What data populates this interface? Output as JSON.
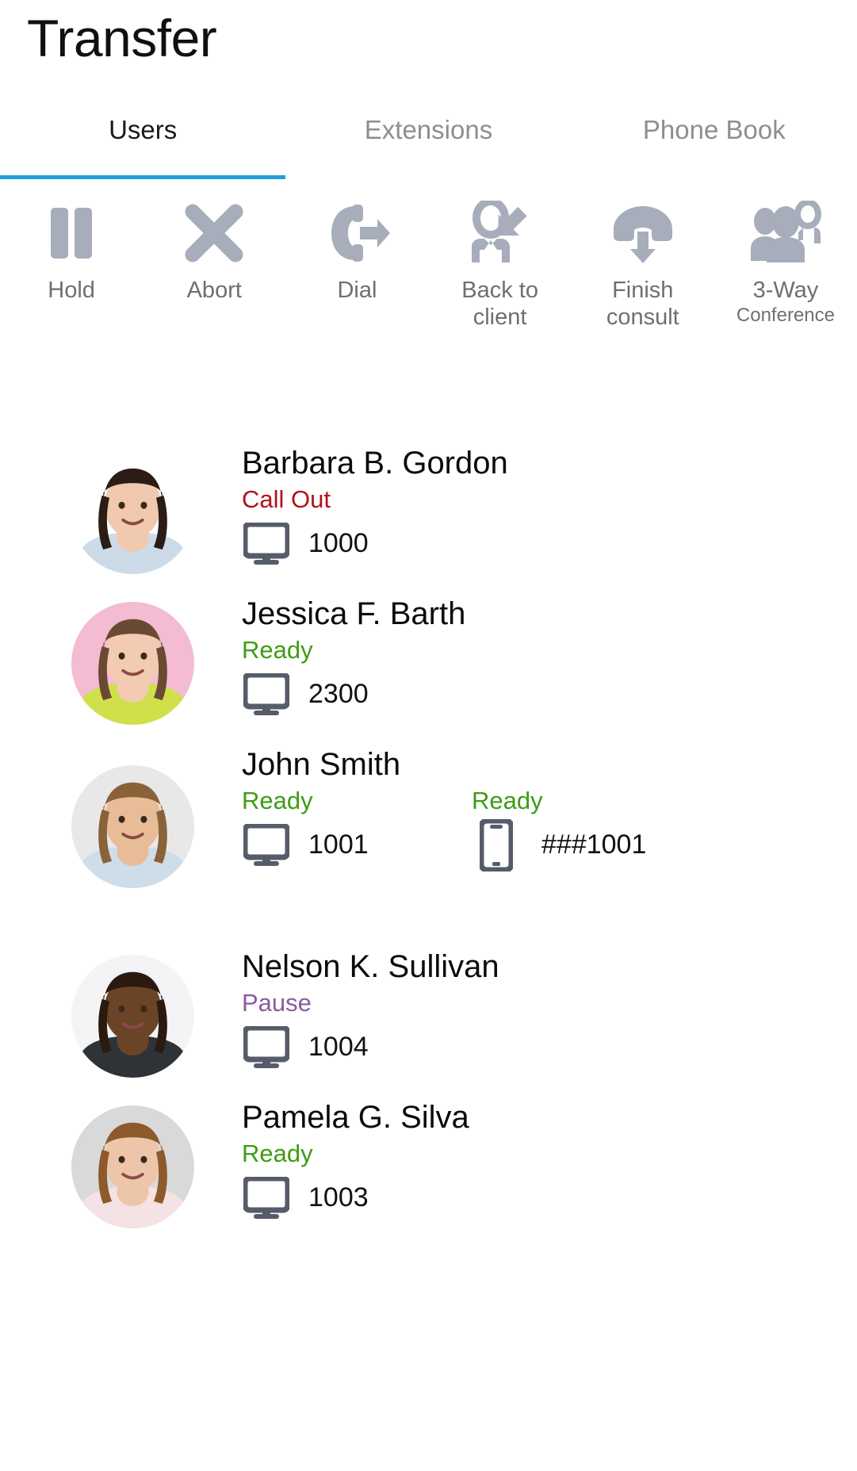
{
  "header": {
    "title": "Transfer"
  },
  "tabs": [
    {
      "label": "Users",
      "active": true
    },
    {
      "label": "Extensions",
      "active": false
    },
    {
      "label": "Phone Book",
      "active": false
    }
  ],
  "toolbar": {
    "accent_color": "#22a0db",
    "icon_color": "#a7adbb",
    "label_color": "#6f6f6f",
    "actions": [
      {
        "icon": "pause-icon",
        "label": "Hold",
        "sublabel": ""
      },
      {
        "icon": "close-x-icon",
        "label": "Abort",
        "sublabel": ""
      },
      {
        "icon": "phone-out-icon",
        "label": "Dial",
        "sublabel": ""
      },
      {
        "icon": "back-to-client-icon",
        "label": "Back to client",
        "sublabel": ""
      },
      {
        "icon": "hangup-icon",
        "label": "Finish consult",
        "sublabel": ""
      },
      {
        "icon": "three-way-conference-icon",
        "label": "3-Way",
        "sublabel": "Conference"
      }
    ]
  },
  "status_colors": {
    "ready": "#3f9c14",
    "call_out": "#b1121b",
    "pause": "#8a5a9e"
  },
  "users": [
    {
      "name": "Barbara B. Gordon",
      "avatar": {
        "bg": "#ffffff",
        "skin": "#f0c9ae",
        "hair": "#2b1d16",
        "top": "#cddbe8"
      },
      "devices": [
        {
          "type": "desktop-icon",
          "status": "Call Out",
          "status_color": "#b1121b",
          "number": "1000"
        }
      ]
    },
    {
      "name": "Jessica F. Barth",
      "avatar": {
        "bg": "#f3bcd2",
        "skin": "#f2cbb2",
        "hair": "#6b4a33",
        "top": "#cfe04a"
      },
      "devices": [
        {
          "type": "desktop-icon",
          "status": "Ready",
          "status_color": "#3f9c14",
          "number": "2300"
        }
      ]
    },
    {
      "name": "John Smith",
      "avatar": {
        "bg": "#e8e8e8",
        "skin": "#e8bc97",
        "hair": "#8a6239",
        "top": "#cfdde9"
      },
      "devices": [
        {
          "type": "desktop-icon",
          "status": "Ready",
          "status_color": "#3f9c14",
          "number": "1001"
        },
        {
          "type": "mobile-icon",
          "status": "Ready",
          "status_color": "#3f9c14",
          "number": "###1001"
        }
      ]
    },
    {
      "name": "Nelson K. Sullivan",
      "avatar": {
        "bg": "#f4f4f6",
        "skin": "#6b4428",
        "hair": "#2a1a10",
        "top": "#2f3337"
      },
      "devices": [
        {
          "type": "desktop-icon",
          "status": "Pause",
          "status_color": "#8a5a9e",
          "number": "1004"
        }
      ]
    },
    {
      "name": "Pamela G. Silva",
      "avatar": {
        "bg": "#d9d9d9",
        "skin": "#edc5a8",
        "hair": "#8d5a2b",
        "top": "#f4e2e4"
      },
      "devices": [
        {
          "type": "desktop-icon",
          "status": "Ready",
          "status_color": "#3f9c14",
          "number": "1003"
        }
      ]
    }
  ]
}
